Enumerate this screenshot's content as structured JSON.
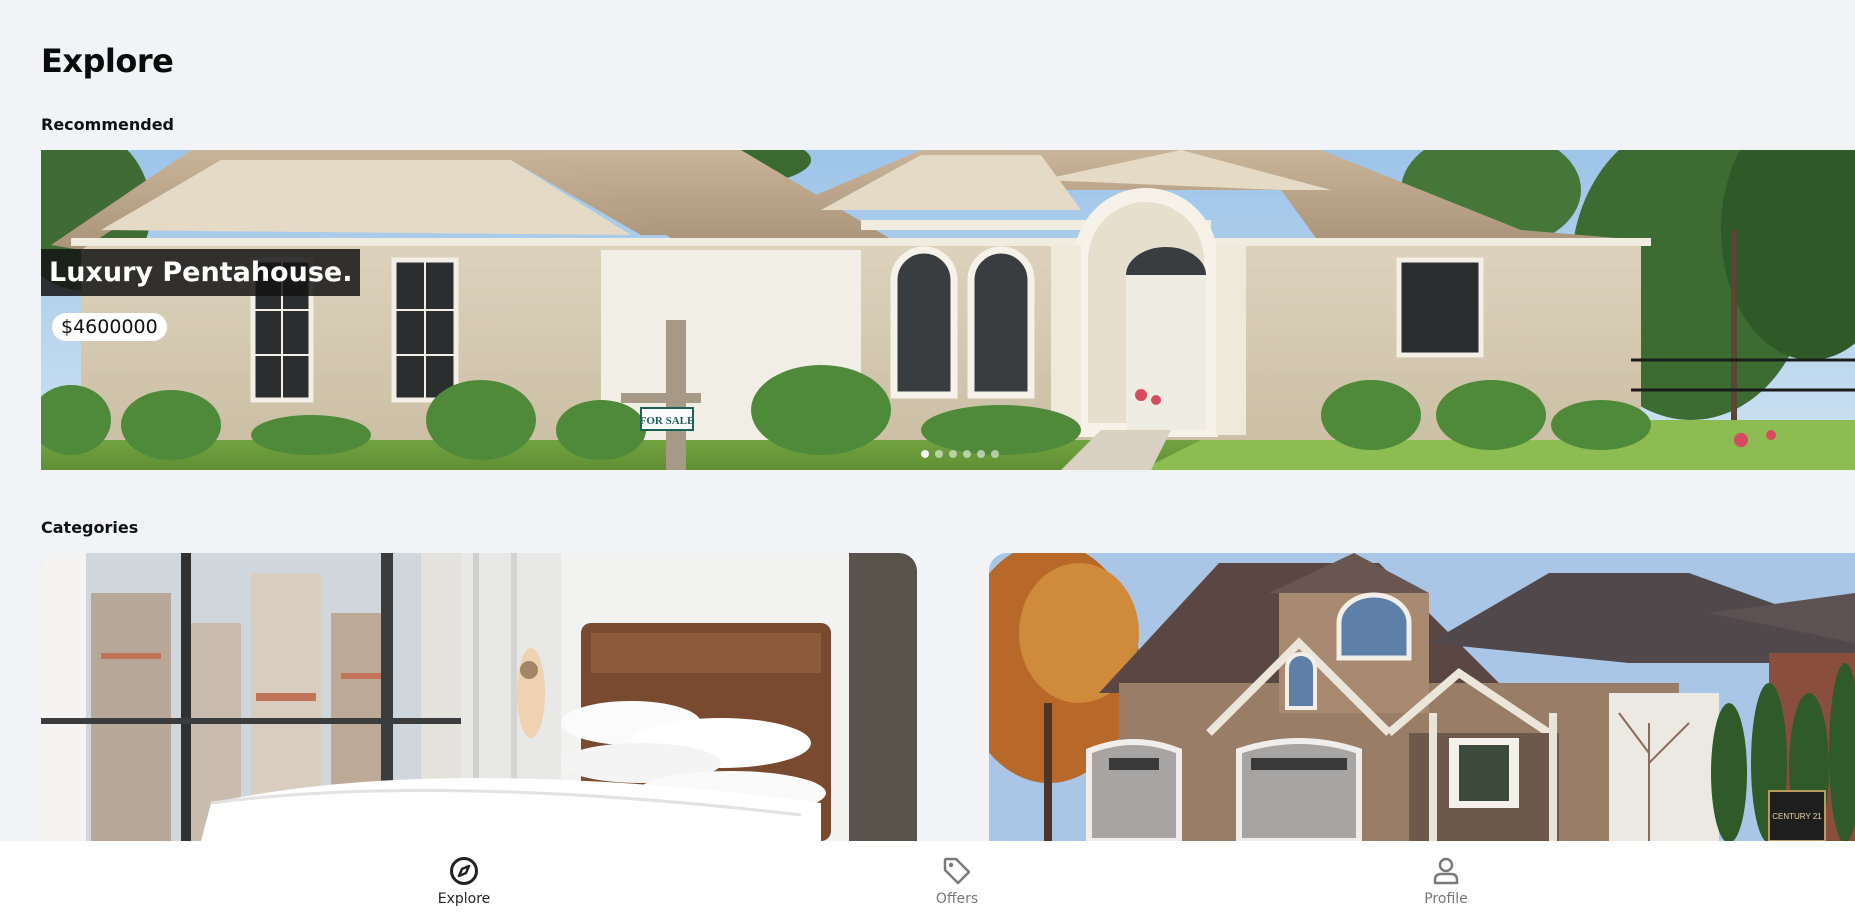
{
  "header": {
    "title": "Explore"
  },
  "sections": {
    "recommended_label": "Recommended",
    "categories_label": "Categories"
  },
  "recommended": {
    "slides_count": 6,
    "active_slide": 1,
    "current": {
      "title": "Luxury Pentahouse.",
      "price": "$4600000",
      "sign_text": "FOR SALE"
    }
  },
  "categories": {
    "items": [
      {
        "image": "bedroom-photo"
      },
      {
        "image": "brick-house-photo",
        "sign_text": "CENTURY 21"
      }
    ]
  },
  "bottom_nav": {
    "items": [
      {
        "label": "Explore",
        "icon": "compass-icon",
        "active": true
      },
      {
        "label": "Offers",
        "icon": "tag-icon",
        "active": false
      },
      {
        "label": "Profile",
        "icon": "person-icon",
        "active": false
      }
    ]
  },
  "colors": {
    "background": "#f2f3f7",
    "nav_active": "#222222",
    "nav_inactive": "#777777",
    "title_overlay": "#141414"
  }
}
